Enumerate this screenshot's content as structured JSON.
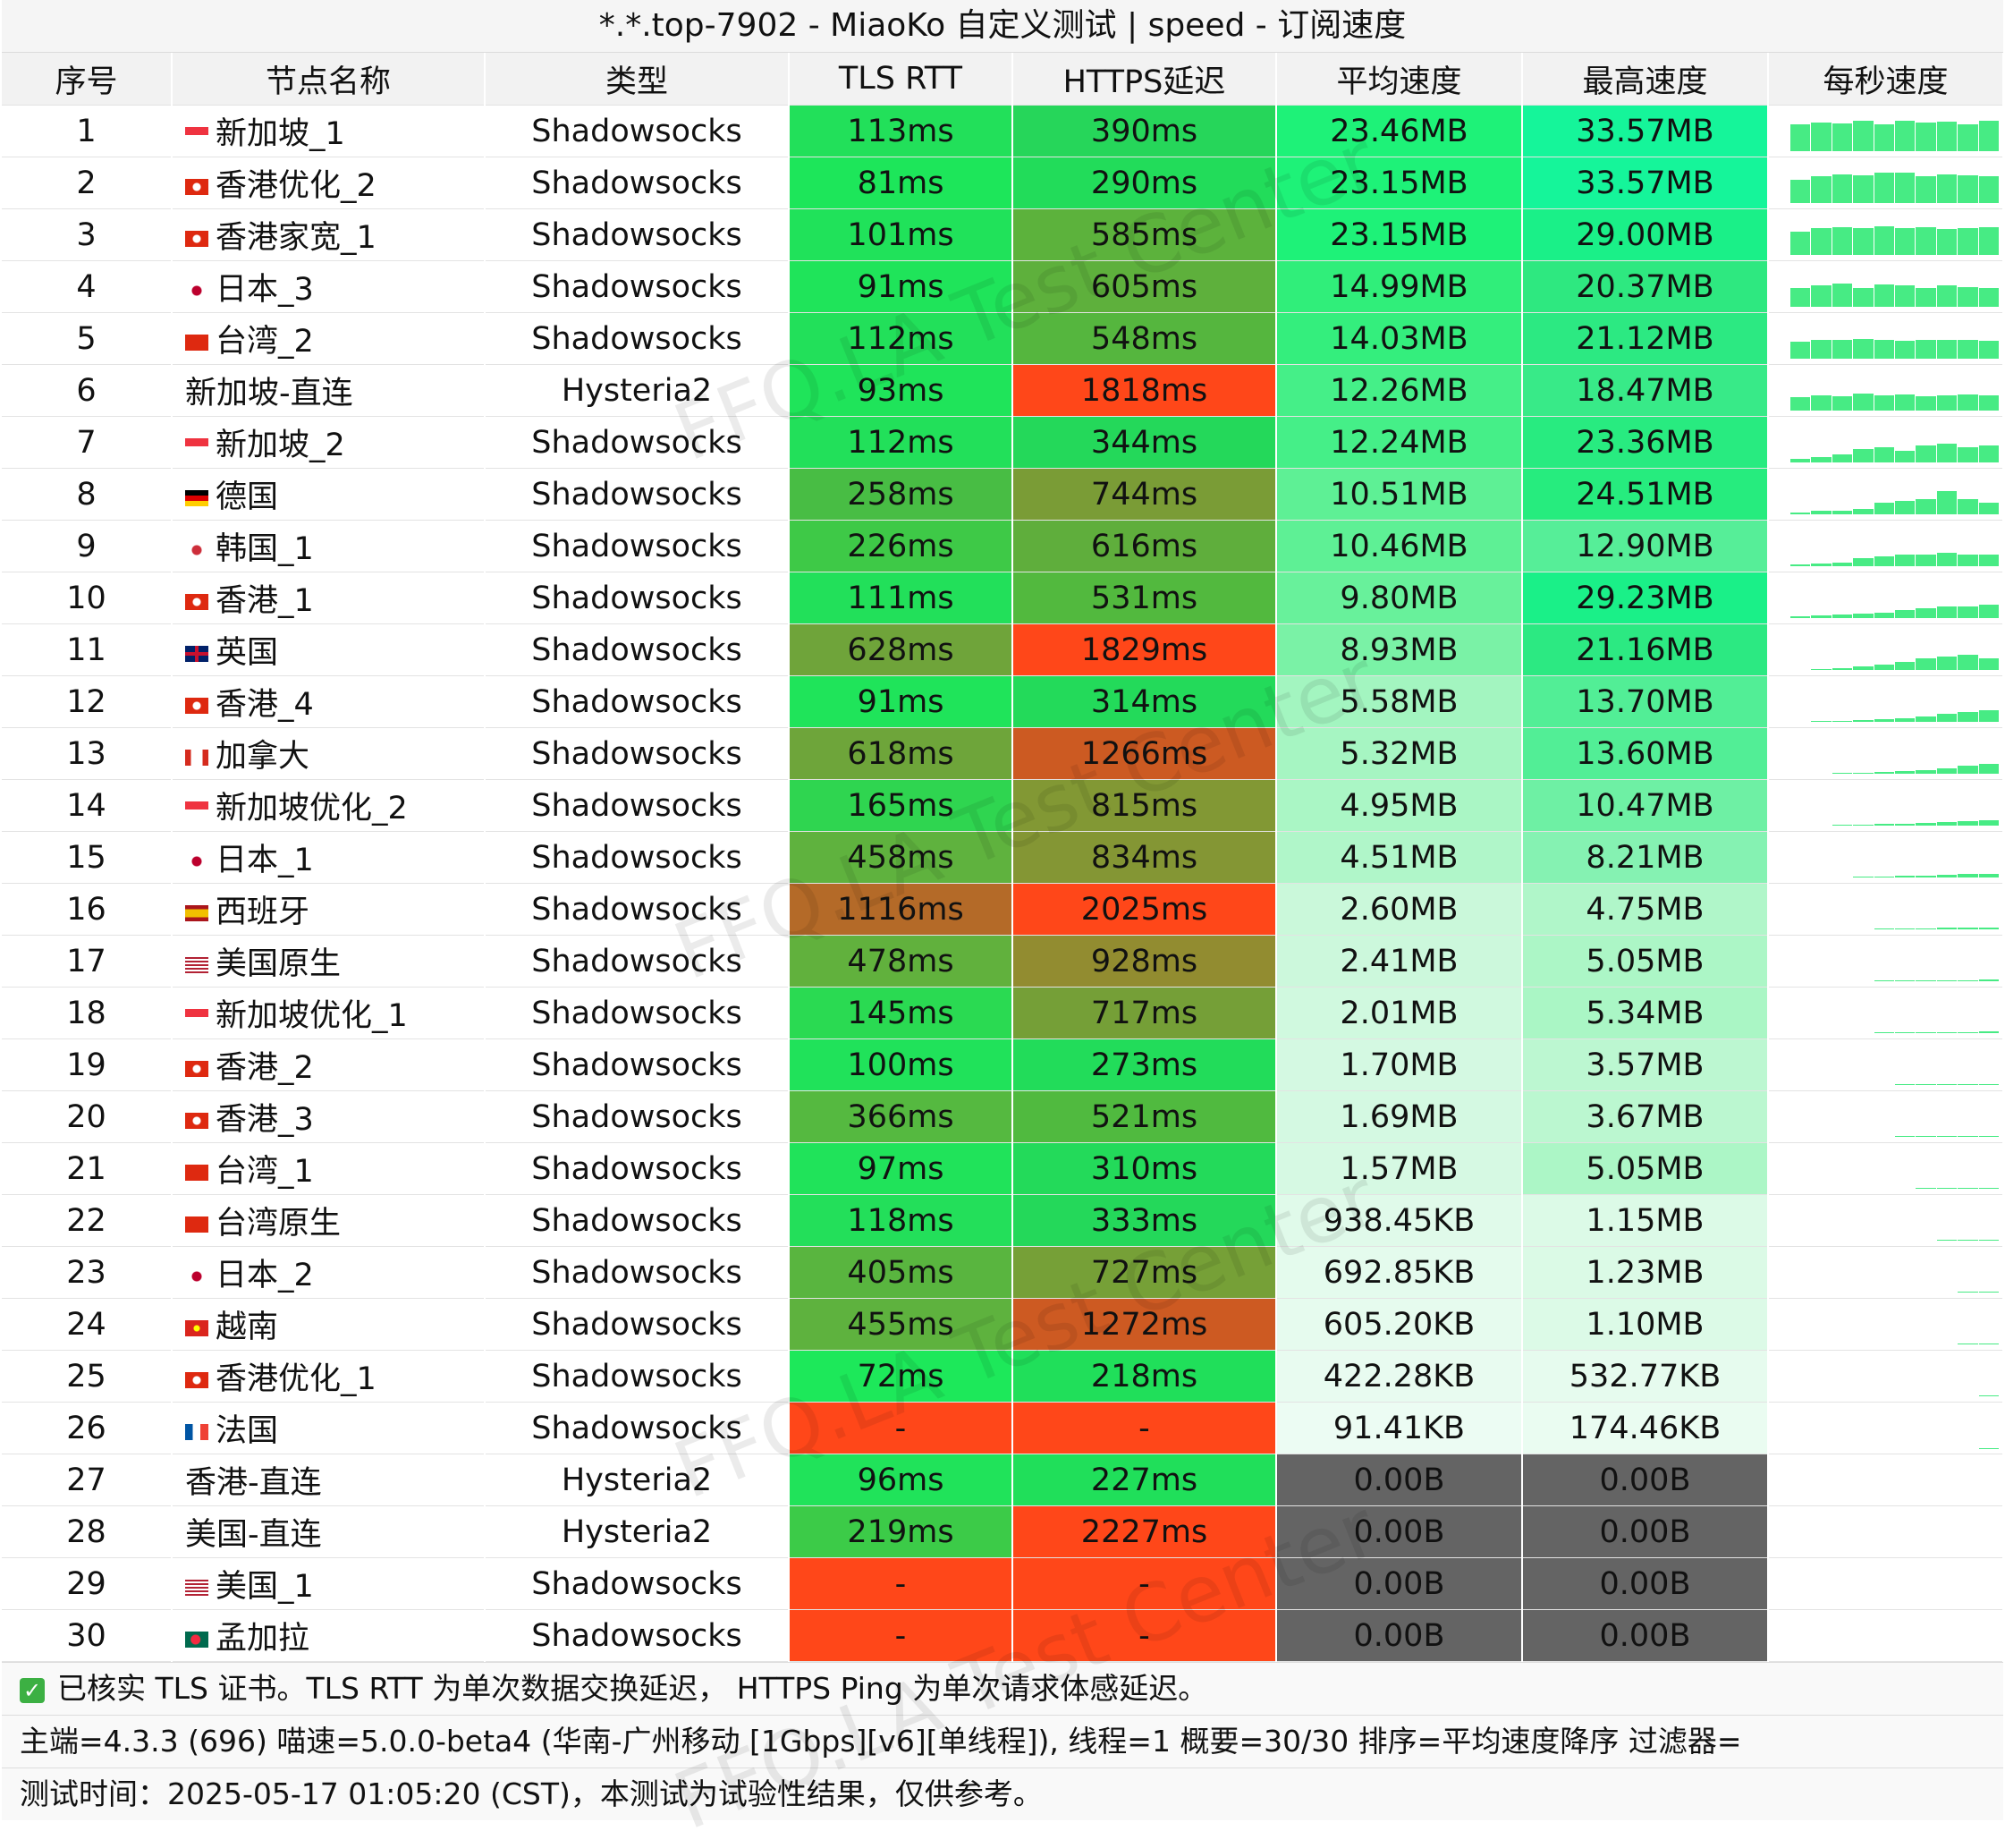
{
  "window": {
    "title": "*.*.top-7902 - MiaoKo 自定义测试 | speed - 订阅速度"
  },
  "columns": [
    "序号",
    "节点名称",
    "类型",
    "TLS RTT",
    "HTTPS延迟",
    "平均速度",
    "最高速度",
    "每秒速度"
  ],
  "rows": [
    {
      "idx": "1",
      "name": "新加坡_1",
      "flag": "sg",
      "type": "Shadowsocks",
      "tls": "113ms",
      "https": "390ms",
      "avg": "23.46MB",
      "max": "33.57MB",
      "tls_c": "#22e05a",
      "https_c": "#26d65a",
      "avg_c": "#1ef278",
      "max_c": "#15f59a",
      "spark": [
        0.7,
        0.75,
        0.72,
        0.8,
        0.7,
        0.78,
        0.74,
        0.76,
        0.7,
        0.8
      ]
    },
    {
      "idx": "2",
      "name": "香港优化_2",
      "flag": "hk",
      "type": "Shadowsocks",
      "tls": "81ms",
      "https": "290ms",
      "avg": "23.15MB",
      "max": "33.57MB",
      "tls_c": "#1de65a",
      "https_c": "#22dc5a",
      "avg_c": "#1ef278",
      "max_c": "#15f59a",
      "spark": [
        0.6,
        0.7,
        0.75,
        0.72,
        0.8,
        0.78,
        0.7,
        0.75,
        0.72,
        0.7
      ]
    },
    {
      "idx": "3",
      "name": "香港家宽_1",
      "flag": "hk",
      "type": "Shadowsocks",
      "tls": "101ms",
      "https": "585ms",
      "avg": "23.15MB",
      "max": "29.00MB",
      "tls_c": "#20e25a",
      "https_c": "#5cb23c",
      "avg_c": "#1ef278",
      "max_c": "#1af088",
      "spark": [
        0.6,
        0.7,
        0.72,
        0.7,
        0.75,
        0.7,
        0.72,
        0.68,
        0.7,
        0.72
      ]
    },
    {
      "idx": "4",
      "name": "日本_3",
      "flag": "jp",
      "type": "Shadowsocks",
      "tls": "91ms",
      "https": "605ms",
      "avg": "14.99MB",
      "max": "20.37MB",
      "tls_c": "#1fe45a",
      "https_c": "#5eb03c",
      "avg_c": "#30ee7a",
      "max_c": "#2ee880",
      "spark": [
        0.5,
        0.55,
        0.6,
        0.5,
        0.58,
        0.55,
        0.5,
        0.55,
        0.52,
        0.5
      ]
    },
    {
      "idx": "5",
      "name": "台湾_2",
      "flag": "cn",
      "type": "Shadowsocks",
      "tls": "112ms",
      "https": "548ms",
      "avg": "14.03MB",
      "max": "21.12MB",
      "tls_c": "#22e05a",
      "https_c": "#55b63e",
      "avg_c": "#34ee7d",
      "max_c": "#2ce982",
      "spark": [
        0.45,
        0.5,
        0.48,
        0.52,
        0.5,
        0.46,
        0.5,
        0.48,
        0.5,
        0.47
      ]
    },
    {
      "idx": "6",
      "name": "新加坡-直连",
      "flag": "",
      "type": "Hysteria2",
      "tls": "93ms",
      "https": "1818ms",
      "avg": "12.26MB",
      "max": "18.47MB",
      "tls_c": "#1fe45a",
      "https_c": "#ff4719",
      "avg_c": "#45ef88",
      "max_c": "#38ea88",
      "spark": [
        0.35,
        0.4,
        0.38,
        0.45,
        0.4,
        0.42,
        0.38,
        0.4,
        0.42,
        0.4
      ]
    },
    {
      "idx": "7",
      "name": "新加坡_2",
      "flag": "sg",
      "type": "Shadowsocks",
      "tls": "112ms",
      "https": "344ms",
      "avg": "12.24MB",
      "max": "23.36MB",
      "tls_c": "#22e05a",
      "https_c": "#24d85a",
      "avg_c": "#45ef88",
      "max_c": "#28eb80",
      "spark": [
        0.1,
        0.15,
        0.2,
        0.35,
        0.4,
        0.3,
        0.45,
        0.5,
        0.4,
        0.45
      ]
    },
    {
      "idx": "8",
      "name": "德国",
      "flag": "de",
      "type": "Shadowsocks",
      "tls": "258ms",
      "https": "744ms",
      "avg": "10.51MB",
      "max": "24.51MB",
      "tls_c": "#48bd44",
      "https_c": "#7a9c36",
      "avg_c": "#5ef095",
      "max_c": "#26ec7e",
      "spark": [
        0.05,
        0.1,
        0.1,
        0.15,
        0.3,
        0.35,
        0.4,
        0.6,
        0.4,
        0.3
      ]
    },
    {
      "idx": "9",
      "name": "韩国_1",
      "flag": "kr",
      "type": "Shadowsocks",
      "tls": "226ms",
      "https": "616ms",
      "avg": "10.46MB",
      "max": "12.90MB",
      "tls_c": "#3ec947",
      "https_c": "#5fae3c",
      "avg_c": "#5ef095",
      "max_c": "#56ee98",
      "spark": [
        0.05,
        0.08,
        0.1,
        0.2,
        0.25,
        0.3,
        0.3,
        0.35,
        0.3,
        0.3
      ]
    },
    {
      "idx": "10",
      "name": "香港_1",
      "flag": "hk",
      "type": "Shadowsocks",
      "tls": "111ms",
      "https": "531ms",
      "avg": "9.80MB",
      "max": "29.23MB",
      "tls_c": "#22e05a",
      "https_c": "#52b93e",
      "avg_c": "#68f19b",
      "max_c": "#1af088",
      "spark": [
        0.05,
        0.08,
        0.1,
        0.12,
        0.15,
        0.2,
        0.25,
        0.3,
        0.3,
        0.35
      ]
    },
    {
      "idx": "11",
      "name": "英国",
      "flag": "gb",
      "type": "Shadowsocks",
      "tls": "628ms",
      "https": "1829ms",
      "avg": "8.93MB",
      "max": "21.16MB",
      "tls_c": "#6fa43a",
      "https_c": "#ff4719",
      "avg_c": "#7af2a6",
      "max_c": "#2ce982",
      "spark": [
        0.0,
        0.02,
        0.05,
        0.1,
        0.15,
        0.2,
        0.3,
        0.35,
        0.4,
        0.3
      ]
    },
    {
      "idx": "12",
      "name": "香港_4",
      "flag": "hk",
      "type": "Shadowsocks",
      "tls": "91ms",
      "https": "314ms",
      "avg": "5.58MB",
      "max": "13.70MB",
      "tls_c": "#1fe45a",
      "https_c": "#23da5a",
      "avg_c": "#a3f5c0",
      "max_c": "#52ee96",
      "spark": [
        0.0,
        0.02,
        0.03,
        0.05,
        0.08,
        0.1,
        0.15,
        0.2,
        0.25,
        0.3
      ]
    },
    {
      "idx": "13",
      "name": "加拿大",
      "flag": "ca",
      "type": "Shadowsocks",
      "tls": "618ms",
      "https": "1266ms",
      "avg": "5.32MB",
      "max": "13.60MB",
      "tls_c": "#6ea53a",
      "https_c": "#cc5a22",
      "avg_c": "#a6f5c2",
      "max_c": "#52ee96",
      "spark": [
        0.0,
        0.0,
        0.02,
        0.03,
        0.05,
        0.08,
        0.1,
        0.15,
        0.2,
        0.25
      ]
    },
    {
      "idx": "14",
      "name": "新加坡优化_2",
      "flag": "sg",
      "type": "Shadowsocks",
      "tls": "165ms",
      "https": "815ms",
      "avg": "4.95MB",
      "max": "10.47MB",
      "tls_c": "#2fd550",
      "https_c": "#829834",
      "avg_c": "#aaf6c5",
      "max_c": "#6ef0a4",
      "spark": [
        0.0,
        0.0,
        0.02,
        0.03,
        0.05,
        0.05,
        0.08,
        0.1,
        0.12,
        0.15
      ]
    },
    {
      "idx": "15",
      "name": "日本_1",
      "flag": "jp",
      "type": "Shadowsocks",
      "tls": "458ms",
      "https": "834ms",
      "avg": "4.51MB",
      "max": "8.21MB",
      "tls_c": "#5fb23e",
      "https_c": "#849634",
      "avg_c": "#b0f6c9",
      "max_c": "#85f2b2",
      "spark": [
        0.0,
        0.0,
        0.0,
        0.02,
        0.03,
        0.05,
        0.05,
        0.08,
        0.1,
        0.1
      ]
    },
    {
      "idx": "16",
      "name": "西班牙",
      "flag": "es",
      "type": "Shadowsocks",
      "tls": "1116ms",
      "https": "2025ms",
      "avg": "2.60MB",
      "max": "4.75MB",
      "tls_c": "#b46a28",
      "https_c": "#ff4719",
      "avg_c": "#caf8da",
      "max_c": "#b0f6c9",
      "spark": [
        0.0,
        0.0,
        0.0,
        0.0,
        0.02,
        0.02,
        0.03,
        0.05,
        0.05,
        0.05
      ]
    },
    {
      "idx": "17",
      "name": "美国原生",
      "flag": "us",
      "type": "Shadowsocks",
      "tls": "478ms",
      "https": "928ms",
      "avg": "2.41MB",
      "max": "5.05MB",
      "tls_c": "#61b13d",
      "https_c": "#928c30",
      "avg_c": "#ccf8dc",
      "max_c": "#acf6c6",
      "spark": [
        0.0,
        0.0,
        0.0,
        0.0,
        0.02,
        0.02,
        0.02,
        0.03,
        0.03,
        0.04
      ]
    },
    {
      "idx": "18",
      "name": "新加坡优化_1",
      "flag": "sg",
      "type": "Shadowsocks",
      "tls": "145ms",
      "https": "717ms",
      "avg": "2.01MB",
      "max": "5.34MB",
      "tls_c": "#2ada52",
      "https_c": "#759f37",
      "avg_c": "#d0f9df",
      "max_c": "#aaf6c5",
      "spark": [
        0.0,
        0.0,
        0.0,
        0.0,
        0.02,
        0.02,
        0.03,
        0.03,
        0.03,
        0.04
      ]
    },
    {
      "idx": "19",
      "name": "香港_2",
      "flag": "hk",
      "type": "Shadowsocks",
      "tls": "100ms",
      "https": "273ms",
      "avg": "1.70MB",
      "max": "3.57MB",
      "tls_c": "#20e25a",
      "https_c": "#22dc5a",
      "avg_c": "#d4f9e2",
      "max_c": "#bcf7d1",
      "spark": [
        0.0,
        0.0,
        0.0,
        0.0,
        0.0,
        0.02,
        0.02,
        0.02,
        0.03,
        0.03
      ]
    },
    {
      "idx": "20",
      "name": "香港_3",
      "flag": "hk",
      "type": "Shadowsocks",
      "tls": "366ms",
      "https": "521ms",
      "avg": "1.69MB",
      "max": "3.67MB",
      "tls_c": "#55b940",
      "https_c": "#50ba3f",
      "avg_c": "#d4f9e2",
      "max_c": "#bbf7d0",
      "spark": [
        0.0,
        0.0,
        0.0,
        0.0,
        0.0,
        0.02,
        0.02,
        0.02,
        0.03,
        0.03
      ]
    },
    {
      "idx": "21",
      "name": "台湾_1",
      "flag": "cn",
      "type": "Shadowsocks",
      "tls": "97ms",
      "https": "310ms",
      "avg": "1.57MB",
      "max": "5.05MB",
      "tls_c": "#20e35a",
      "https_c": "#23da5a",
      "avg_c": "#d6f9e3",
      "max_c": "#acf6c6",
      "spark": [
        0.0,
        0.0,
        0.0,
        0.0,
        0.0,
        0.0,
        0.02,
        0.02,
        0.02,
        0.03
      ]
    },
    {
      "idx": "22",
      "name": "台湾原生",
      "flag": "cn",
      "type": "Shadowsocks",
      "tls": "118ms",
      "https": "333ms",
      "avg": "938.45KB",
      "max": "1.15MB",
      "tls_c": "#23df5a",
      "https_c": "#24d85a",
      "avg_c": "#e0faea",
      "max_c": "#dcfae7",
      "spark": [
        0.0,
        0.0,
        0.0,
        0.0,
        0.0,
        0.0,
        0.0,
        0.02,
        0.02,
        0.02
      ]
    },
    {
      "idx": "23",
      "name": "日本_2",
      "flag": "jp",
      "type": "Shadowsocks",
      "tls": "405ms",
      "https": "727ms",
      "avg": "692.85KB",
      "max": "1.23MB",
      "tls_c": "#59b53f",
      "https_c": "#76a037",
      "avg_c": "#e4fbed",
      "max_c": "#dbfae6",
      "spark": [
        0.0,
        0.0,
        0.0,
        0.0,
        0.0,
        0.0,
        0.0,
        0.0,
        0.02,
        0.02
      ]
    },
    {
      "idx": "24",
      "name": "越南",
      "flag": "vn",
      "type": "Shadowsocks",
      "tls": "455ms",
      "https": "1272ms",
      "avg": "605.20KB",
      "max": "1.10MB",
      "tls_c": "#5eb23e",
      "https_c": "#cd5a22",
      "avg_c": "#e6fbee",
      "max_c": "#dcfae7",
      "spark": [
        0.0,
        0.0,
        0.0,
        0.0,
        0.0,
        0.0,
        0.0,
        0.0,
        0.02,
        0.02
      ]
    },
    {
      "idx": "25",
      "name": "香港优化_1",
      "flag": "hk",
      "type": "Shadowsocks",
      "tls": "72ms",
      "https": "218ms",
      "avg": "422.28KB",
      "max": "532.77KB",
      "tls_c": "#1de85a",
      "https_c": "#20df5a",
      "avg_c": "#e8fbf0",
      "max_c": "#e6fbee",
      "spark": [
        0.0,
        0.0,
        0.0,
        0.0,
        0.0,
        0.0,
        0.0,
        0.0,
        0.0,
        0.02
      ]
    },
    {
      "idx": "26",
      "name": "法国",
      "flag": "fr",
      "type": "Shadowsocks",
      "tls": "-",
      "https": "-",
      "avg": "91.41KB",
      "max": "174.46KB",
      "tls_c": "#ff4719",
      "https_c": "#ff4719",
      "avg_c": "#ecfcf3",
      "max_c": "#eafcf1",
      "spark": [
        0.0,
        0.0,
        0.0,
        0.0,
        0.0,
        0.0,
        0.0,
        0.0,
        0.0,
        0.01
      ]
    },
    {
      "idx": "27",
      "name": "香港-直连",
      "flag": "",
      "type": "Hysteria2",
      "tls": "96ms",
      "https": "227ms",
      "avg": "0.00B",
      "max": "0.00B",
      "tls_c": "#20e35a",
      "https_c": "#20df5a",
      "avg_c": "#646464",
      "max_c": "#646464",
      "spark": []
    },
    {
      "idx": "28",
      "name": "美国-直连",
      "flag": "",
      "type": "Hysteria2",
      "tls": "219ms",
      "https": "2227ms",
      "avg": "0.00B",
      "max": "0.00B",
      "tls_c": "#3ccb48",
      "https_c": "#ff4719",
      "avg_c": "#646464",
      "max_c": "#646464",
      "spark": []
    },
    {
      "idx": "29",
      "name": "美国_1",
      "flag": "us",
      "type": "Shadowsocks",
      "tls": "-",
      "https": "-",
      "avg": "0.00B",
      "max": "0.00B",
      "tls_c": "#ff4719",
      "https_c": "#ff4719",
      "avg_c": "#646464",
      "max_c": "#646464",
      "spark": []
    },
    {
      "idx": "30",
      "name": "孟加拉",
      "flag": "bd",
      "type": "Shadowsocks",
      "tls": "-",
      "https": "-",
      "avg": "0.00B",
      "max": "0.00B",
      "tls_c": "#ff4719",
      "https_c": "#ff4719",
      "avg_c": "#646464",
      "max_c": "#646464",
      "spark": []
    }
  ],
  "footer": {
    "line1": "已核实 TLS 证书。TLS RTT 为单次数据交换延迟， HTTPS Ping 为单次请求体感延迟。",
    "line2": "主端=4.3.3 (696) 喵速=5.0.0-beta4 (华南-广州移动 [1Gbps][v6][单线程]), 线程=1 概要=30/30 排序=平均速度降序 过滤器=",
    "line3": "测试时间：2025-05-17 01:05:20 (CST)，本测试为试验性结果，仅供参考。"
  },
  "watermark": "FFQ.LA Test Center"
}
